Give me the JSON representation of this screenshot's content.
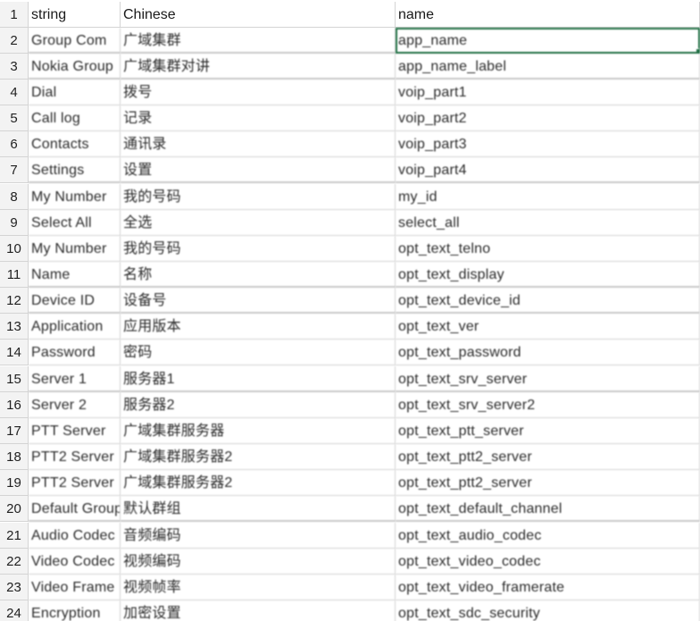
{
  "sheet": {
    "selected_row": 2,
    "selected_column": "name",
    "rows": [
      {
        "n": "1",
        "string": "string",
        "chinese": "Chinese",
        "name": "name"
      },
      {
        "n": "2",
        "string": "Group Com",
        "chinese": "广域集群",
        "name": "app_name"
      },
      {
        "n": "3",
        "string": "Nokia Group",
        "chinese": "广域集群对讲",
        "name": "app_name_label"
      },
      {
        "n": "4",
        "string": "Dial",
        "chinese": "拨号",
        "name": "voip_part1"
      },
      {
        "n": "5",
        "string": "Call log",
        "chinese": "记录",
        "name": "voip_part2"
      },
      {
        "n": "6",
        "string": "Contacts",
        "chinese": "通讯录",
        "name": "voip_part3"
      },
      {
        "n": "7",
        "string": "Settings",
        "chinese": "设置",
        "name": "voip_part4"
      },
      {
        "n": "8",
        "string": "My Number",
        "chinese": "我的号码",
        "name": "my_id"
      },
      {
        "n": "9",
        "string": "Select All",
        "chinese": "全选",
        "name": "select_all"
      },
      {
        "n": "10",
        "string": "My Number",
        "chinese": "我的号码",
        "name": "opt_text_telno"
      },
      {
        "n": "11",
        "string": "Name",
        "chinese": "名称",
        "name": "opt_text_display"
      },
      {
        "n": "12",
        "string": "Device ID",
        "chinese": "设备号",
        "name": "opt_text_device_id"
      },
      {
        "n": "13",
        "string": "Application",
        "chinese": "应用版本",
        "name": "opt_text_ver"
      },
      {
        "n": "14",
        "string": "Password",
        "chinese": "密码",
        "name": "opt_text_password"
      },
      {
        "n": "15",
        "string": "Server 1",
        "chinese": "服务器1",
        "name": "opt_text_srv_server"
      },
      {
        "n": "16",
        "string": "Server 2",
        "chinese": "服务器2",
        "name": "opt_text_srv_server2"
      },
      {
        "n": "17",
        "string": "PTT Server",
        "chinese": "广域集群服务器",
        "name": "opt_text_ptt_server"
      },
      {
        "n": "18",
        "string": "PTT2 Server",
        "chinese": "广域集群服务器2",
        "name": "opt_text_ptt2_server"
      },
      {
        "n": "19",
        "string": "PTT2 Server",
        "chinese": "广域集群服务器2",
        "name": "opt_text_ptt2_server"
      },
      {
        "n": "20",
        "string": "Default Group",
        "chinese": "默认群组",
        "name": "opt_text_default_channel"
      },
      {
        "n": "21",
        "string": "Audio Codec",
        "chinese": "音频编码",
        "name": "opt_text_audio_codec"
      },
      {
        "n": "22",
        "string": "Video Codec",
        "chinese": "视频编码",
        "name": "opt_text_video_codec"
      },
      {
        "n": "23",
        "string": "Video Frame",
        "chinese": "视频帧率",
        "name": "opt_text_video_framerate"
      },
      {
        "n": "24",
        "string": "Encryption",
        "chinese": "加密设置",
        "name": "opt_text_sdc_security"
      }
    ]
  },
  "colors": {
    "selection": "#1f6e43",
    "gridline": "#d4d4d4",
    "header_bg": "#f3f3f3"
  }
}
